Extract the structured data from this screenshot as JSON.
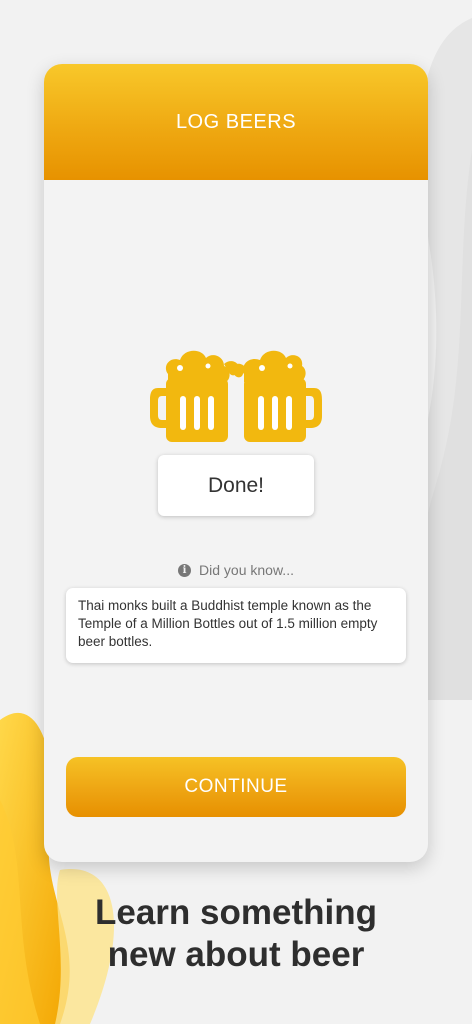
{
  "header": {
    "title": "LOG BEERS"
  },
  "illustration": {
    "icon": "beer-mugs-cheers-icon",
    "color": "#f2b80f"
  },
  "done_button": {
    "label": "Done!"
  },
  "did_you_know": {
    "label": "Did you know...",
    "icon": "info-icon"
  },
  "fact": {
    "text": "Thai monks built a Buddhist temple known as the Temple of a Million Bottles out of 1.5 million empty beer bottles."
  },
  "continue_button": {
    "label": "CONTINUE"
  },
  "tagline": {
    "line1": "Learn something",
    "line2": "new about beer"
  },
  "colors": {
    "accent": "#eea513",
    "accent_light": "#f8c82a",
    "accent_dark": "#e79200"
  }
}
